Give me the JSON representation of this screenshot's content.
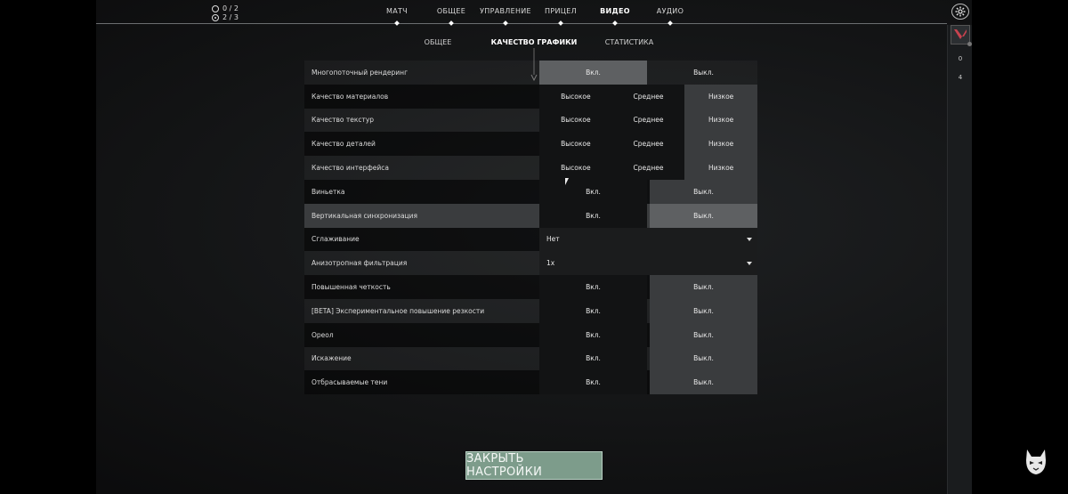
{
  "counters": [
    {
      "icon": "clock-icon",
      "text": "0 / 2"
    },
    {
      "icon": "target-icon",
      "text": "2 / 3"
    }
  ],
  "nav": {
    "items": [
      {
        "label": "МАТЧ",
        "active": false
      },
      {
        "label": "ОБЩЕЕ",
        "active": false
      },
      {
        "label": "УПРАВЛЕНИЕ",
        "active": false
      },
      {
        "label": "ПРИЦЕЛ",
        "active": false
      },
      {
        "label": "ВИДЕО",
        "active": true
      },
      {
        "label": "АУДИО",
        "active": false
      }
    ]
  },
  "subnav": {
    "items": [
      {
        "label": "ОБЩЕЕ",
        "active": false
      },
      {
        "label": "КАЧЕСТВО ГРАФИКИ",
        "active": true
      },
      {
        "label": "СТАТИСТИКА",
        "active": false
      }
    ]
  },
  "right_panel": {
    "numbers": [
      "0",
      "4"
    ]
  },
  "settings": [
    {
      "label": "Многопоточный рендеринг",
      "type": "two",
      "options": [
        "Вкл.",
        "Выкл."
      ],
      "selected": 0
    },
    {
      "label": "Качество материалов",
      "type": "three",
      "options": [
        "Высокое",
        "Среднее",
        "Низкое"
      ],
      "selected": 2
    },
    {
      "label": "Качество текстур",
      "type": "three",
      "options": [
        "Высокое",
        "Среднее",
        "Низкое"
      ],
      "selected": 2
    },
    {
      "label": "Качество деталей",
      "type": "three",
      "options": [
        "Высокое",
        "Среднее",
        "Низкое"
      ],
      "selected": 2
    },
    {
      "label": "Качество интерфейса",
      "type": "three",
      "options": [
        "Высокое",
        "Среднее",
        "Низкое"
      ],
      "selected": 2
    },
    {
      "label": "Виньетка",
      "type": "two",
      "options": [
        "Вкл.",
        "Выкл."
      ],
      "selected": 1
    },
    {
      "label": "Вертикальная синхронизация",
      "type": "two",
      "options": [
        "Вкл.",
        "Выкл."
      ],
      "selected": 1
    },
    {
      "label": "Сглаживание",
      "type": "dropdown",
      "value": "Нет"
    },
    {
      "label": "Анизотропная фильтрация",
      "type": "dropdown",
      "value": "1x"
    },
    {
      "label": "Повышенная четкость",
      "type": "two",
      "options": [
        "Вкл.",
        "Выкл."
      ],
      "selected": 1
    },
    {
      "label": "[BETA] Экспериментальное повышение резкости",
      "type": "two",
      "options": [
        "Вкл.",
        "Выкл."
      ],
      "selected": 1
    },
    {
      "label": "Ореол",
      "type": "two",
      "options": [
        "Вкл.",
        "Выкл."
      ],
      "selected": 1
    },
    {
      "label": "Искажение",
      "type": "two",
      "options": [
        "Вкл.",
        "Выкл."
      ],
      "selected": 1
    },
    {
      "label": "Отбрасываемые тени",
      "type": "two",
      "options": [
        "Вкл.",
        "Выкл."
      ],
      "selected": 1
    }
  ],
  "close_button": {
    "label": "ЗАКРЫТЬ НАСТРОЙКИ"
  },
  "colors": {
    "accent_button": "#7d9c8b",
    "badge_red": "#c8434f"
  }
}
